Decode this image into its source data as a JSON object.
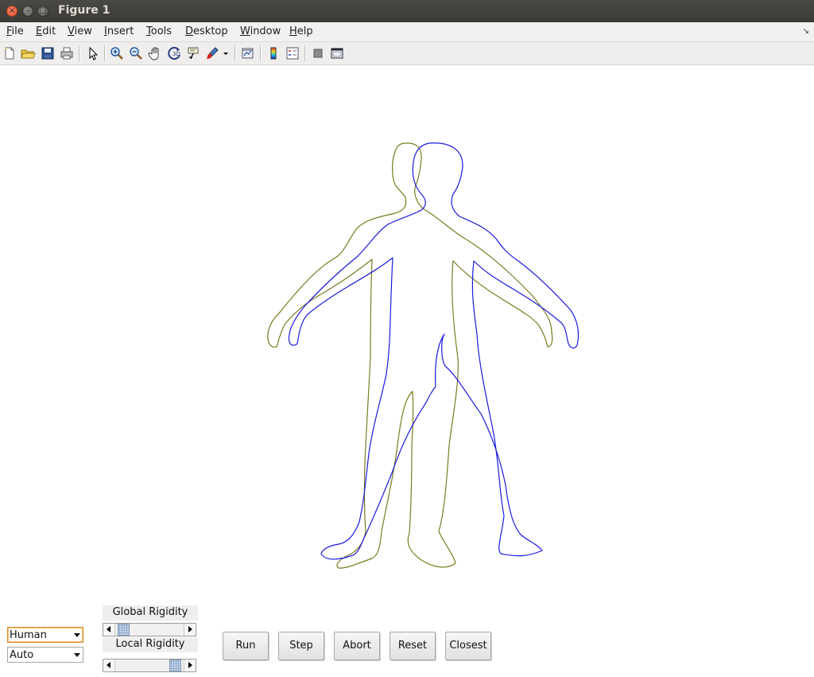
{
  "window": {
    "title": "Figure 1"
  },
  "menu": {
    "items": [
      {
        "label": "File",
        "mnemonic": "F",
        "rest": "ile"
      },
      {
        "label": "Edit",
        "mnemonic": "E",
        "rest": "dit"
      },
      {
        "label": "View",
        "mnemonic": "V",
        "rest": "iew"
      },
      {
        "label": "Insert",
        "mnemonic": "I",
        "rest": "nsert"
      },
      {
        "label": "Tools",
        "mnemonic": "T",
        "rest": "ools"
      },
      {
        "label": "Desktop",
        "mnemonic": "D",
        "rest": "esktop"
      },
      {
        "label": "Window",
        "mnemonic": "W",
        "rest": "indow"
      },
      {
        "label": "Help",
        "mnemonic": "H",
        "rest": "elp"
      }
    ]
  },
  "toolbar": {
    "icons": [
      "new-figure-icon",
      "open-file-icon",
      "save-icon",
      "print-icon",
      "edit-plot-arrow-icon",
      "zoom-in-icon",
      "zoom-out-icon",
      "pan-hand-icon",
      "rotate-3d-icon",
      "data-cursor-icon",
      "brush-icon",
      "brush-dropdown-icon",
      "link-plot-icon",
      "colorbar-icon",
      "legend-icon",
      "hide-plot-tools-icon",
      "show-plot-tools-icon"
    ]
  },
  "plot": {
    "shape_colors": {
      "reference": "#7a7a1e",
      "deformed": "#1a1adf"
    },
    "background": "#ffffff"
  },
  "controls": {
    "shape_popup": {
      "value": "Human"
    },
    "mode_popup": {
      "value": "Auto"
    },
    "global_rigidity": {
      "label": "Global Rigidity",
      "level": 0.05
    },
    "local_rigidity": {
      "label": "Local Rigidity",
      "level": 0.95
    },
    "buttons": {
      "run": "Run",
      "step": "Step",
      "abort": "Abort",
      "reset": "Reset",
      "closest": "Closest"
    }
  }
}
